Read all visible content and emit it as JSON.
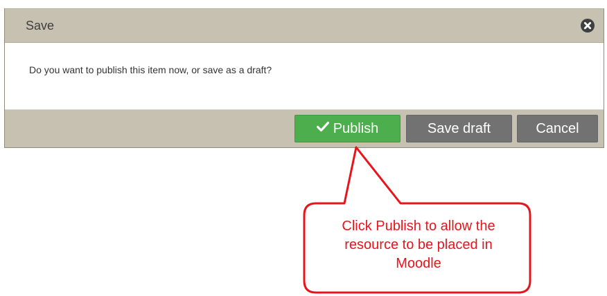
{
  "dialog": {
    "title": "Save",
    "message": "Do you want to publish this item now, or save as a draft?",
    "close_icon": "close-circle-icon",
    "buttons": {
      "publish_label": "Publish",
      "publish_icon": "checkmark-icon",
      "save_draft_label": "Save draft",
      "cancel_label": "Cancel"
    }
  },
  "callout": {
    "lines": [
      "Click Publish to allow the",
      "resource to be placed in",
      "Moodle"
    ]
  },
  "colors": {
    "header_bg": "#c6c1b1",
    "publish_green": "#4cae4c",
    "secondary_gray": "#727272",
    "callout_red": "#e8141b"
  }
}
